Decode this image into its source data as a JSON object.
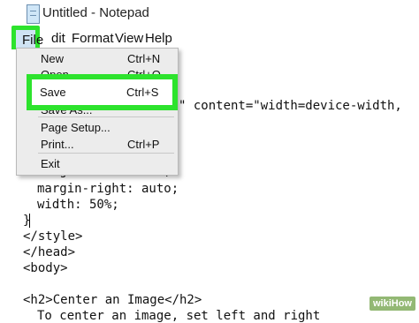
{
  "window": {
    "title": "Untitled - Notepad"
  },
  "menubar": {
    "items": [
      "File",
      "Edit",
      "Format",
      "View",
      "Help"
    ],
    "edit_visible": "dit"
  },
  "file_menu": {
    "items": [
      {
        "label": "New",
        "shortcut": "Ctrl+N"
      },
      {
        "label": "Open...",
        "shortcut": "Ctrl+O"
      },
      {
        "label": "Save",
        "shortcut": "Ctrl+S"
      },
      {
        "label": "Save As...",
        "shortcut": ""
      },
      {
        "label": "Page Setup...",
        "shortcut": ""
      },
      {
        "label": "Print...",
        "shortcut": "Ctrl+P"
      },
      {
        "label": "Exit",
        "shortcut": ""
      }
    ]
  },
  "editor": {
    "lines": [
      "\" content=\"width=device-width,",
      "margin-left: auto;",
      "margin-right: auto;",
      "width: 50%;",
      "}",
      "</style>",
      "</head>",
      "<body>",
      "",
      "<h2>Center an Image</h2>",
      "To center an image, set left and right"
    ]
  },
  "watermark": "wikiHow",
  "colors": {
    "highlight": "#2de32d",
    "menu_bg": "#ececec"
  }
}
